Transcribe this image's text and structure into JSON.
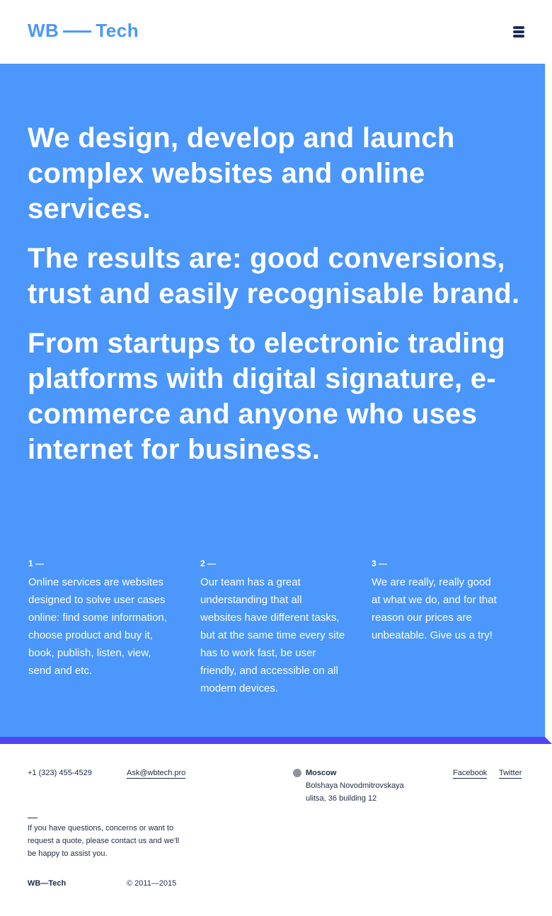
{
  "header": {
    "logo_left": "WB",
    "logo_right": "Tech",
    "menu_icon": "hamburger-menu-icon"
  },
  "hero": {
    "statements": [
      "We design, develop and launch complex websites and online services.",
      "The results are: good conversions, trust and easily recognisable brand.",
      "From startups to electronic trading platforms with digital signature, e-commerce and anyone who uses internet for business."
    ],
    "columns": [
      {
        "number": "1 —",
        "text": "Online services are websites designed to solve user cases online: find some information, choose product and buy it, book, publish, listen, view, send and etc."
      },
      {
        "number": "2 —",
        "text": "Our team has a great understanding that all websites have different tasks, but at the same time every site has to work fast, be user friendly, and accessible on all modern devices."
      },
      {
        "number": "3 —",
        "text": "We are really, really good at what we do, and for that reason our prices are unbeatable. Give us a try!"
      }
    ]
  },
  "footer": {
    "phone": "+1 (323) 455-4529",
    "email": "Ask@wbtech.pro",
    "location_city": "Moscow",
    "location_address": "Bolshaya Novodmitrovskaya ulitsa, 36 building 12",
    "social": {
      "facebook": "Facebook",
      "twitter": "Twitter"
    },
    "note": "If you have questions, concerns or want to request a quote, please contact us and we’ll be happy to assist you.",
    "brand": "WB—Tech",
    "copyright": "© 2011—2015"
  },
  "colors": {
    "accent_blue": "#4b97fb",
    "stripe_purple": "#4f45f2",
    "text_dark": "#1d2a44",
    "location_dot": "#8f939b"
  }
}
